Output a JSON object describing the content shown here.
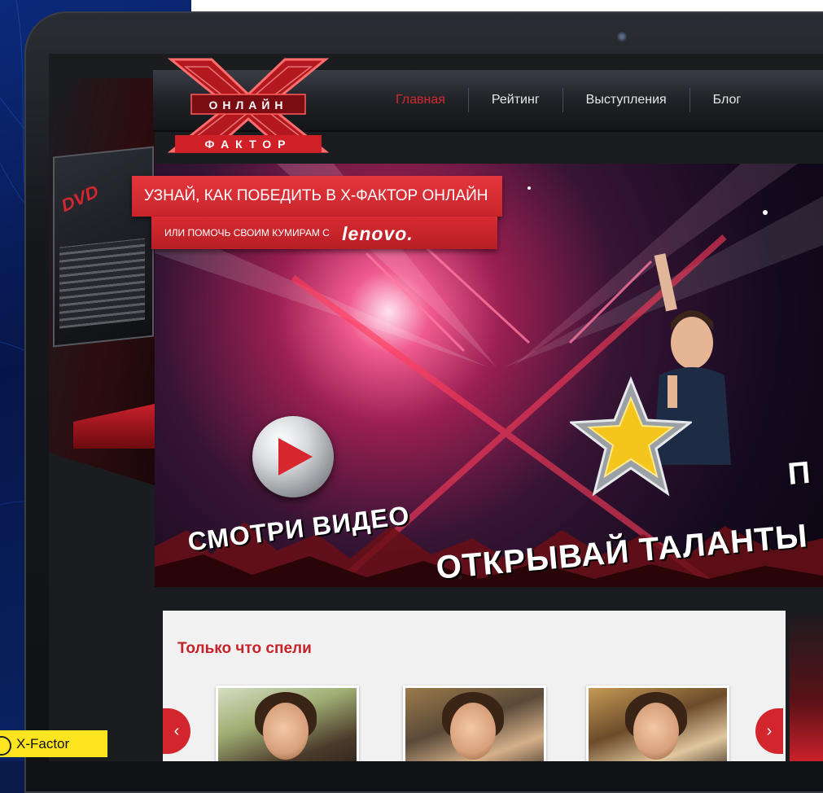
{
  "site": {
    "logo_top": "ОНЛАЙН",
    "logo_bottom": "ФАКТОР"
  },
  "nav": {
    "items": [
      "Главная",
      "Рейтинг",
      "Выступления",
      "Блог"
    ],
    "active_index": 0
  },
  "hero": {
    "banner_line1": "УЗНАЙ, КАК ПОБЕДИТЬ В Х-ФАКТОР ОНЛАЙН",
    "banner_line2": "ИЛИ ПОМОЧЬ СВОИМ КУМИРАМ С",
    "brand": "lenovo.",
    "cta_watch": "СМОТРИ ВИДЕО",
    "cta_discover": "ОТКРЫВАЙ ТАЛАНТЫ",
    "cta_partial": "П"
  },
  "section": {
    "title": "Только что спели",
    "prev_icon": "‹",
    "next_icon": "›"
  },
  "caption": {
    "label": "X-Factor"
  },
  "colors": {
    "accent_red": "#d22a2f",
    "caption_yellow": "#ffe51f"
  }
}
